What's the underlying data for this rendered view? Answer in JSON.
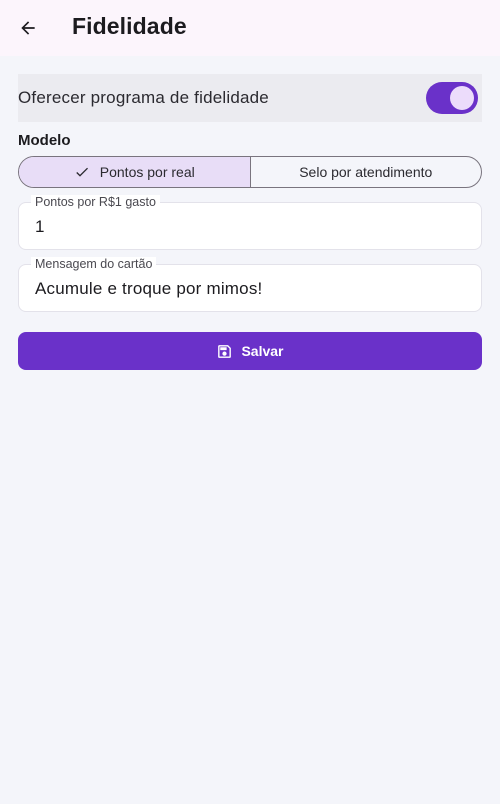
{
  "header": {
    "title": "Fidelidade",
    "back_icon": "arrow-back-icon"
  },
  "loyalty_toggle": {
    "label": "Oferecer programa de fidelidade",
    "enabled": true
  },
  "model": {
    "label": "Modelo",
    "options": [
      {
        "label": "Pontos por real",
        "selected": true
      },
      {
        "label": "Selo por atendimento",
        "selected": false
      }
    ]
  },
  "fields": {
    "points": {
      "label": "Pontos por R$1 gasto",
      "value": "1"
    },
    "message": {
      "label": "Mensagem do cartão",
      "value": "Acumule e troque por mimos!"
    }
  },
  "save_button": {
    "label": "Salvar",
    "icon": "save-icon"
  },
  "colors": {
    "primary": "#6a31c9",
    "app_bar": "#fcf5fc",
    "background": "#f4f5fa",
    "selected_segment": "#e8ddf7"
  }
}
